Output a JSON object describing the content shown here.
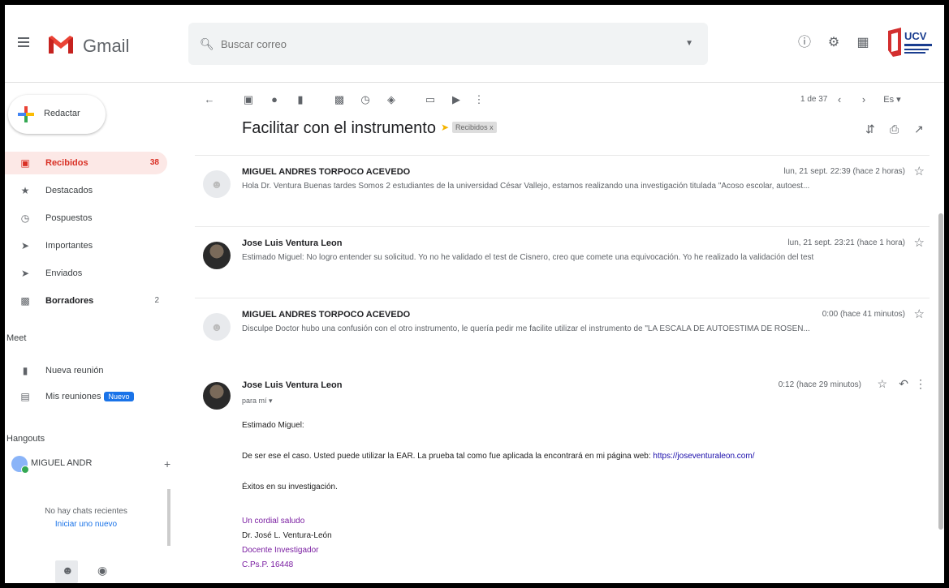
{
  "header": {
    "app_name": "Gmail",
    "search_placeholder": "Buscar correo",
    "ucv_logo_text": "UCV"
  },
  "sidebar": {
    "compose_label": "Redactar",
    "items": [
      {
        "label": "Recibidos",
        "count": "38",
        "icon": "inbox-icon"
      },
      {
        "label": "Destacados",
        "count": "",
        "icon": "star-icon"
      },
      {
        "label": "Pospuestos",
        "count": "",
        "icon": "clock-icon"
      },
      {
        "label": "Importantes",
        "count": "",
        "icon": "important-icon"
      },
      {
        "label": "Enviados",
        "count": "",
        "icon": "send-icon"
      },
      {
        "label": "Borradores",
        "count": "2",
        "icon": "draft-icon"
      }
    ],
    "meet_title": "Meet",
    "meet_items": [
      {
        "label": "Nueva reunión",
        "icon": "video-icon"
      },
      {
        "label": "Mis reuniones",
        "badge": "Nuevo",
        "icon": "calendar-icon"
      }
    ],
    "hangouts_title": "Hangouts",
    "hangout_user": "MIGUEL ANDR",
    "no_chats": "No hay chats recientes",
    "start_new": "Iniciar uno nuevo"
  },
  "toolbar": {
    "pager": "1 de 37",
    "lang": "Es"
  },
  "thread": {
    "subject": "Facilitar con el instrumento",
    "label": "Recibidos x",
    "messages": [
      {
        "sender": "MIGUEL ANDRES TORPOCO ACEVEDO",
        "time": "lun, 21 sept. 22:39 (hace 2 horas)",
        "snippet": "Hola Dr. Ventura Buenas tardes Somos 2 estudiantes de la universidad César Vallejo, estamos realizando una investigación titulada \"Acoso escolar, autoest..."
      },
      {
        "sender": "Jose Luis Ventura Leon",
        "time": "lun, 21 sept. 23:21 (hace 1 hora)",
        "snippet": "Estimado Miguel: No logro entender su solicitud. Yo no he validado el test de Cisnero, creo que comete una equivocación. Yo he realizado la validación del test"
      },
      {
        "sender": "MIGUEL ANDRES TORPOCO ACEVEDO",
        "time": "0:00 (hace 41 minutos)",
        "snippet": "Disculpe Doctor hubo una confusión con el otro instrumento, le quería pedir me facilite utilizar el instrumento de \"LA ESCALA DE AUTOESTIMA DE ROSEN..."
      }
    ],
    "open_message": {
      "sender": "Jose Luis Ventura Leon",
      "to": "para mí ▾",
      "time": "0:12 (hace 29 minutos)",
      "greeting": "Estimado Miguel:",
      "body1": "De ser ese el caso. Usted puede utilizar la EAR. La prueba tal como fue aplicada la encontrará en mi página web:",
      "link": "https://joseventuraleon.com/",
      "body2": "Éxitos en su investigación.",
      "sig": [
        "Un cordial saludo",
        "Dr. José L. Ventura-León",
        "Docente Investigador",
        "C.Ps.P. 16448"
      ]
    }
  }
}
